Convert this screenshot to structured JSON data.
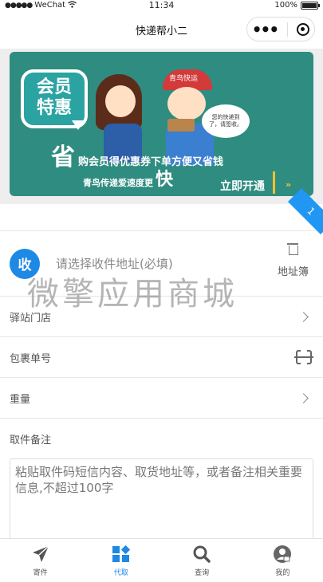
{
  "status_bar": {
    "carrier": "WeChat",
    "time": "11:34",
    "battery": "100%"
  },
  "navbar": {
    "title": "快递帮小二"
  },
  "banner": {
    "badge_line1": "会员",
    "badge_line2": "特惠",
    "brand": "青鸟快运",
    "speech": "您的快递到了，请签收。",
    "slogan_big": "省",
    "slogan_text": "购会员得优惠券下单方便又省钱",
    "slogan2_text": "青鸟传递爱速度更",
    "slogan2_big": "快",
    "cta": "立即开通",
    "cta_arrow": "»"
  },
  "ribbon": {
    "label": "1"
  },
  "address": {
    "badge": "收",
    "placeholder": "请选择收件地址(必填)",
    "book_label": "地址簿"
  },
  "watermark": "微擎应用商城",
  "form": {
    "station": "驿站门店",
    "tracking": "包裹单号",
    "weight": "重量",
    "note_label": "取件备注",
    "note_placeholder": "粘贴取件码短信内容、取货地址等，或者备注相关重要信息,不超过100字"
  },
  "tabbar": {
    "items": [
      {
        "label": "寄件",
        "icon": "send-icon"
      },
      {
        "label": "代取",
        "icon": "pickup-icon"
      },
      {
        "label": "查询",
        "icon": "search-icon"
      },
      {
        "label": "我的",
        "icon": "user-icon"
      }
    ],
    "active": "代取",
    "accent": "#1e88e5"
  }
}
